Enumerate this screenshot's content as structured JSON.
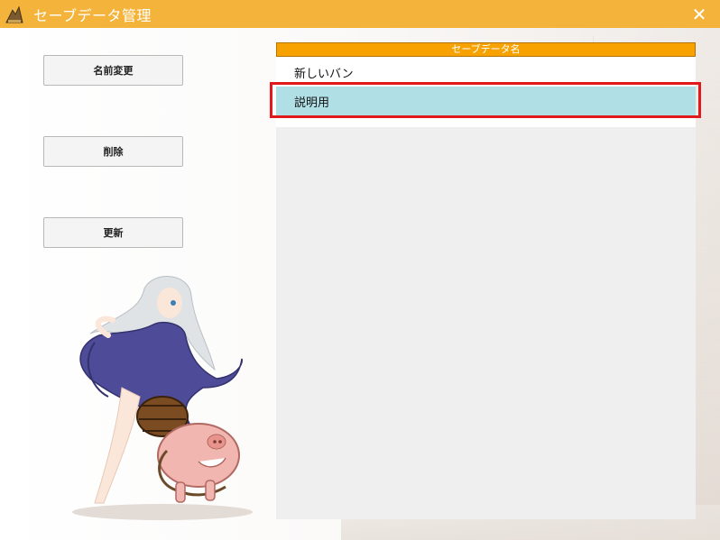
{
  "window": {
    "title": "セーブデータ管理",
    "close_glyph": "✕"
  },
  "actions": {
    "rename_label": "名前変更",
    "delete_label": "削除",
    "refresh_label": "更新"
  },
  "save_list": {
    "header": "セーブデータ名",
    "rows": [
      {
        "name": "新しいバン",
        "selected": false
      },
      {
        "name": "説明用",
        "selected": true
      }
    ]
  },
  "colors": {
    "titlebar": "#f4b33a",
    "header": "#f7a200",
    "selection": "#b0dfe6",
    "annotation": "#e01a1a"
  },
  "icons": {
    "app": "app-emblem-icon",
    "close": "close-icon"
  }
}
